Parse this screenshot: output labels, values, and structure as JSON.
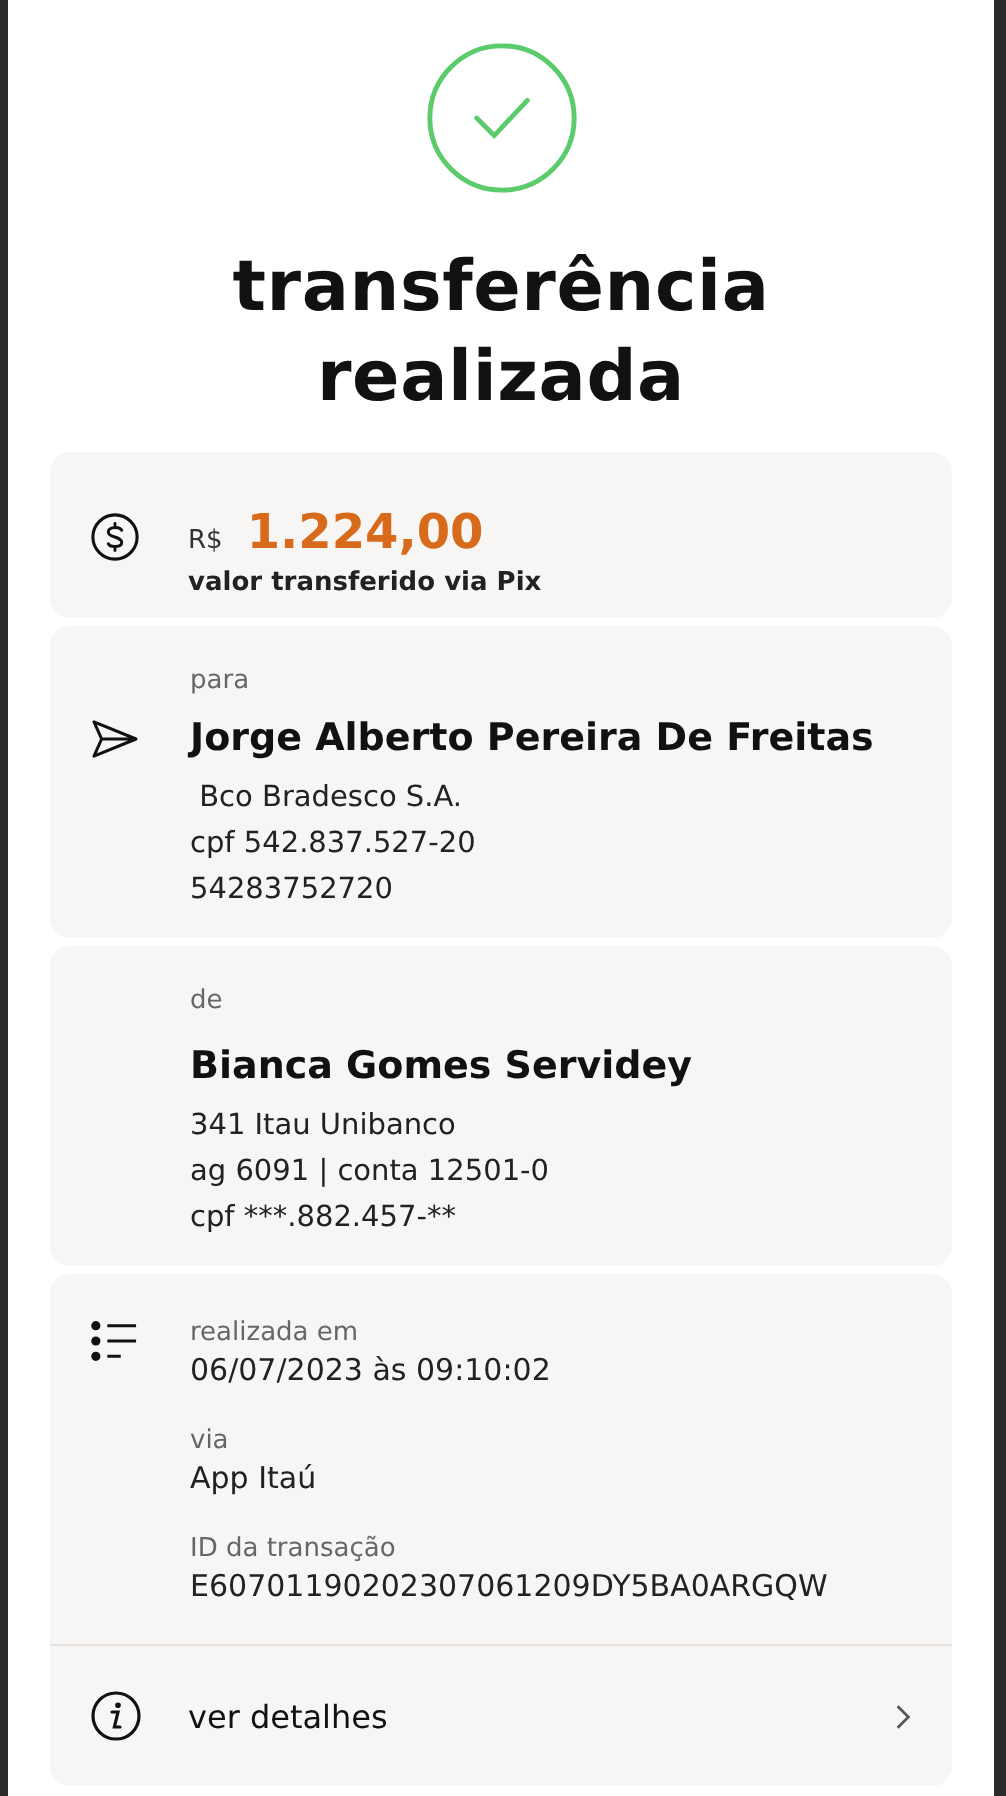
{
  "status": {
    "title": "transferência realizada"
  },
  "amount": {
    "currency": "R$",
    "value": "1.224,00",
    "caption": "valor transferido via Pix"
  },
  "recipient": {
    "label": "para",
    "name": "Jorge Alberto Pereira De Freitas",
    "lines": [
      " Bco Bradesco S.A.",
      "cpf 542.837.527-20",
      "54283752720"
    ]
  },
  "sender": {
    "label": "de",
    "name": "Bianca Gomes Servidey",
    "lines": [
      "341 Itau Unibanco",
      "ag 6091 | conta 12501-0",
      "cpf ***.882.457-**"
    ]
  },
  "details": [
    {
      "label": "realizada em",
      "value": "06/07/2023 às 09:10:02"
    },
    {
      "label": "via",
      "value": "App Itaú"
    },
    {
      "label": "ID da transação",
      "value": "E60701190202307061209DY5BA0ARGQW"
    }
  ],
  "more": {
    "label": "ver detalhes"
  }
}
